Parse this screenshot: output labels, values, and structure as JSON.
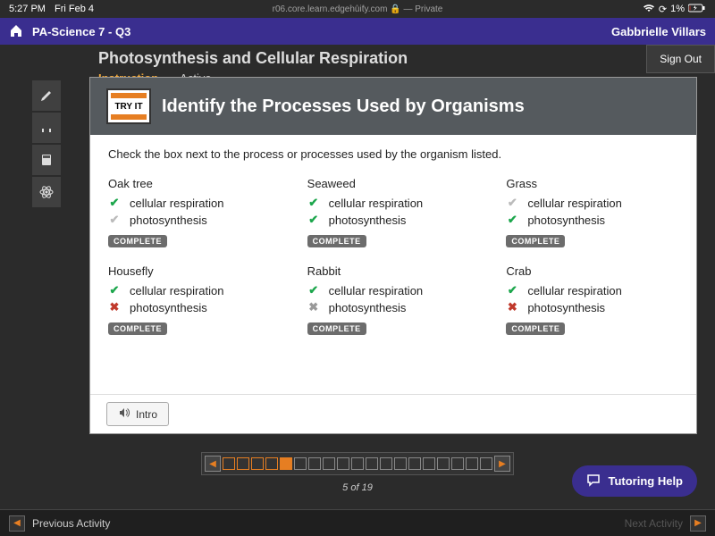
{
  "status": {
    "time": "5:27 PM",
    "date": "Fri Feb 4",
    "url": "r06.core.learn.edgenuity.com",
    "url_suffix": " — Private",
    "battery": "1%"
  },
  "header": {
    "course": "PA-Science 7 - Q3",
    "user": "Gabbrielle Villars"
  },
  "user_menu": {
    "sign_out": "Sign Out"
  },
  "lesson": {
    "title": "Photosynthesis and Cellular Respiration",
    "tab_instruction": "Instruction",
    "tab_active": "Active"
  },
  "card": {
    "badge": "TRY IT",
    "title": "Identify the Processes Used by Organisms",
    "prompt": "Check the box next to the process or processes used by the organism listed.",
    "intro_btn": "Intro"
  },
  "organisms": [
    {
      "name": "Oak tree",
      "options": [
        {
          "mark": "check-green",
          "label": "cellular respiration"
        },
        {
          "mark": "check-gray",
          "label": "photosynthesis"
        }
      ],
      "status": "COMPLETE"
    },
    {
      "name": "Seaweed",
      "options": [
        {
          "mark": "check-green",
          "label": "cellular respiration"
        },
        {
          "mark": "check-green",
          "label": "photosynthesis"
        }
      ],
      "status": "COMPLETE"
    },
    {
      "name": "Grass",
      "options": [
        {
          "mark": "check-gray",
          "label": "cellular respiration"
        },
        {
          "mark": "check-green",
          "label": "photosynthesis"
        }
      ],
      "status": "COMPLETE"
    },
    {
      "name": "Housefly",
      "options": [
        {
          "mark": "check-green",
          "label": "cellular respiration"
        },
        {
          "mark": "x-red",
          "label": "photosynthesis"
        }
      ],
      "status": "COMPLETE"
    },
    {
      "name": "Rabbit",
      "options": [
        {
          "mark": "check-green",
          "label": "cellular respiration"
        },
        {
          "mark": "x-gray",
          "label": "photosynthesis"
        }
      ],
      "status": "COMPLETE"
    },
    {
      "name": "Crab",
      "options": [
        {
          "mark": "check-green",
          "label": "cellular respiration"
        },
        {
          "mark": "x-red",
          "label": "photosynthesis"
        }
      ],
      "status": "COMPLETE"
    }
  ],
  "pager": {
    "total": 19,
    "current": 5,
    "completed_upto": 5,
    "label": "5 of 19"
  },
  "tutoring": {
    "label": "Tutoring Help"
  },
  "bottom": {
    "prev": "Previous Activity",
    "next": "Next Activity"
  }
}
